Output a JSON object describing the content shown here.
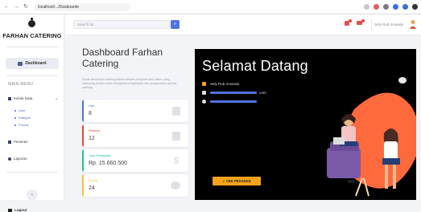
{
  "browser": {
    "url": "localhost/.../Dasboarde"
  },
  "sidebar": {
    "brand": "FARHAN CATERING",
    "active_item": "Dashboard",
    "section_title": "MAIN MENU",
    "items": [
      {
        "label": "Kelola Data"
      },
      {
        "label": "Pesanan"
      },
      {
        "label": "Laporan"
      }
    ],
    "sub_items": [
      "User",
      "Kategori",
      "Produk"
    ],
    "collapse_symbol": "‹",
    "logout": "Logout"
  },
  "topbar": {
    "search_placeholder": "Search for...",
    "user_name": "Sely Rub Amanda"
  },
  "main": {
    "title": "Dashboard Farhan Catering",
    "description": "Pusat dashboard catering adalah sebuah penyedia atau sistem yang dirancang khusus untuk mengelola pengelolaan dan pengawasan operasi catering."
  },
  "stats": [
    {
      "label": "User",
      "value": "8",
      "color": "#4e73df"
    },
    {
      "label": "Pesanan",
      "value": "12",
      "color": "#e74a3b"
    },
    {
      "label": "Total Pendapatan",
      "value": "Rp. 15.660.500",
      "color": "#1cc88a"
    },
    {
      "label": "Produk",
      "value": "24",
      "color": "#f6c23e"
    }
  ],
  "welcome": {
    "title": "Selamat Datang",
    "name": "Sely Rub Amanda",
    "email_suffix": ".com",
    "cta": "✓ CEK PESANAN"
  },
  "colors": {
    "accent": "#4e73df",
    "cta": "#f5a21f",
    "illustration": "#ff6a3d"
  }
}
